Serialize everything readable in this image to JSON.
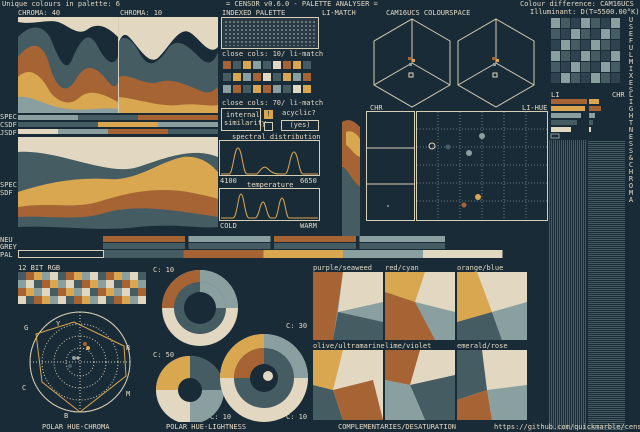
{
  "header": {
    "unique_colours": "Unique colours in palette: 6",
    "title": "= CENSOR v0.6.0 - PALETTE ANALYSER =",
    "colour_difference": "Colour difference: CAM16UCS",
    "illuminant": "Illuminant: D(T=5500.00°K)"
  },
  "labels": {
    "chroma40": "CHROMA: 40",
    "chroma10": "CHROMA: 10",
    "indexed_palette": "INDEXED PALETTE",
    "li_match_top": "LI-MATCH",
    "cam16ucs": "CAM16UCS COLOURSPACE",
    "close_cols_10": "close cols: 10/ li-match",
    "close_cols_70": "close cols: 70/ li-match",
    "internal_similarity_1": "internal",
    "internal_similarity_2": "similarity",
    "cyclic": "acyclic?",
    "yes": "(yes)",
    "spectral": "spectral distribution",
    "wl_min": "4100",
    "wl_max": "6650",
    "temperature": "temperature",
    "cold": "COLD",
    "warm": "WARM",
    "chr_left": "CHR",
    "li_hue": "LI-HUE",
    "li": "LI",
    "chr_right": "CHR",
    "spec": "SPEC",
    "csdf": "CSDF",
    "jsdf": "JSDF",
    "spec2": "SPEC",
    "sdf": "SDF",
    "neu": "NEU",
    "grey": "GREY",
    "pal": "PAL",
    "bit12": "12 BIT RGB",
    "c10": "C: 10",
    "c30": "C: 30",
    "c50": "C: 50",
    "c10b": "C: 10",
    "c10c": "C: 10",
    "polar_hue_chroma": "POLAR HUE-CHROMA",
    "polar_hue_lightness": "POLAR HUE-LIGHTNESS",
    "complementaries": "COMPLEMENTARIES/DESATURATION",
    "github": "https://github.com/quickmarble/censor",
    "purple_seaweed": "purple/seaweed",
    "red_cyan": "red/cyan",
    "orange_blue": "orange/blue",
    "olive_ultramarine": "olive/ultramarine",
    "lime_violet": "lime/violet",
    "emerald_rose": "emerald/rose",
    "side_useful": "USEFUL MIXES",
    "side_light": "LIGHTNESS & CHROMA",
    "hc_g": "G",
    "hc_y": "Y",
    "hc_r": "R",
    "hc_c": "C",
    "hc_b": "B",
    "hc_m": "M"
  },
  "palette": {
    "colors": [
      "#1a2b38",
      "#455c63",
      "#8a9fa0",
      "#a66434",
      "#d9a750",
      "#e2d8c2"
    ]
  },
  "icons": {
    "warning": "warning-icon",
    "checkbox": "checkbox-icon"
  }
}
